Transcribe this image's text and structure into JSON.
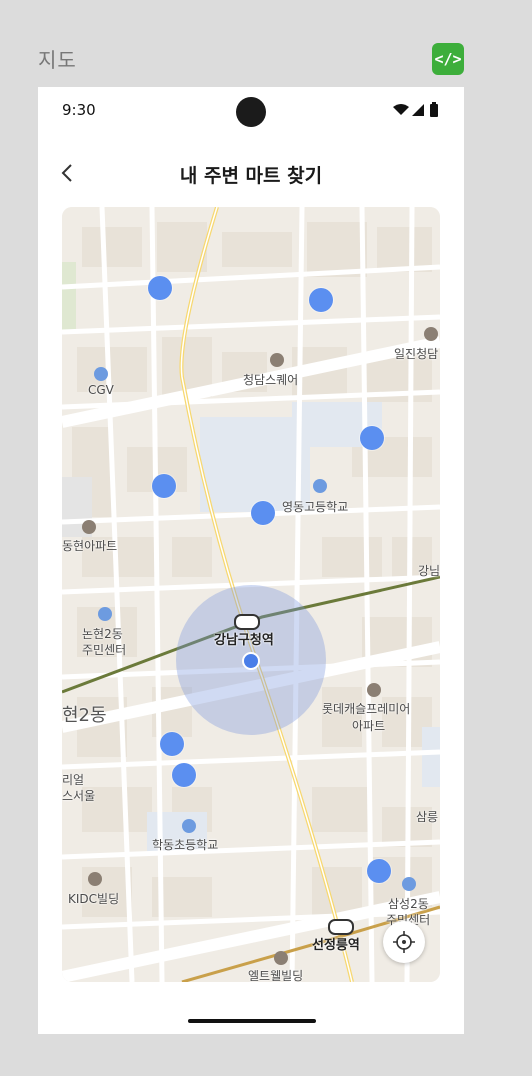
{
  "frame": {
    "title": "지도",
    "code_badge": "</>",
    "badge_color": "#3dae3b"
  },
  "status_bar": {
    "time": "9:30",
    "icons": [
      "wifi-icon",
      "signal-icon",
      "battery-icon"
    ]
  },
  "header": {
    "back_icon": "chevron-left-icon",
    "title": "내 주변 마트 찾기"
  },
  "map": {
    "labels": {
      "cheongdam_square": "청담스퀘어",
      "cgv": "CGV",
      "iljin": "일진청담",
      "yeongdong_high": "영동고등학교",
      "apartment_west": "동현아파트",
      "gangnam_east": "강님",
      "nonhyeon_center_line1": "논현2동",
      "nonhyeon_center_line2": "주민센터",
      "station_main": "강남구청역",
      "district": "현2동",
      "lotte_line1": "롯데캐슬프레미어",
      "lotte_line2": "아파트",
      "real_line1": "리얼",
      "real_line2": "스서울",
      "samneung": "삼릉",
      "hakdong_school": "학동초등학교",
      "kidc": "KIDC빌딩",
      "samseong_line1": "삼성2동",
      "samseong_line2": "주민센터",
      "station_south": "선정릉역",
      "eltewell": "엘트웰빌딩"
    },
    "store_marker_count": 9,
    "store_marker_color": "#5b8ff0",
    "radius_color": "#7896dc",
    "my_location_color": "#4a7ee8",
    "locate_icon": "crosshair-icon"
  }
}
